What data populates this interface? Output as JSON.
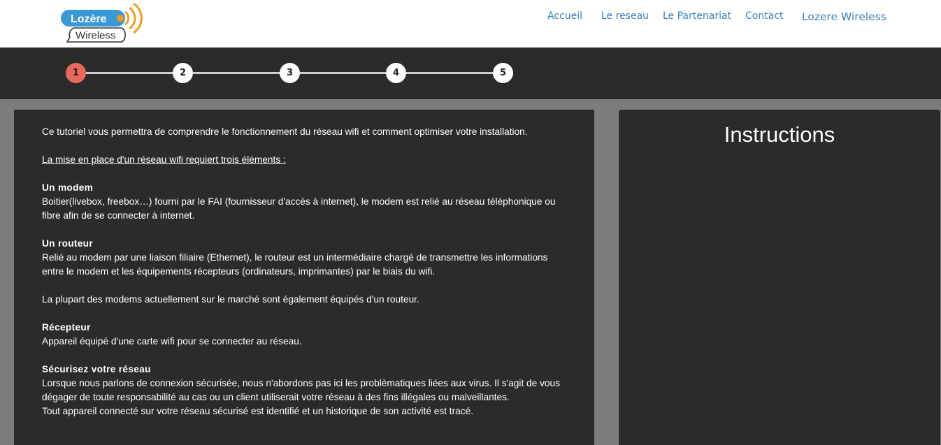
{
  "logo": {
    "line1": "Lozère",
    "line2": "Wireless",
    "colors": {
      "blue": "#3b98d6",
      "orange": "#f39a1f",
      "dark": "#333333"
    }
  },
  "nav": {
    "items": [
      "Accueil",
      "Le reseau",
      "Le Partenariat",
      "Contact"
    ],
    "brand": "Lozere Wireless"
  },
  "steps": {
    "items": [
      "1",
      "2",
      "3",
      "4",
      "5"
    ],
    "active_index": 0,
    "active_color": "#e8685a"
  },
  "content": {
    "intro": "Ce tutoriel vous permettra de comprendre le fonctionnement du réseau wifi et comment optimiser votre installation.",
    "subtitle": "La mise en place d'un réseau wifi requiert trois éléments :",
    "modem_title": "Un modem",
    "modem_text": "Boitier(livebox, freebox…) fourni par le FAI (fournisseur d'accès à internet), le modem est relié au réseau téléphonique ou fibre afin de se connecter à internet.",
    "router_title": "Un routeur",
    "router_text": "Relié au modem par une liaison filiaire (Ethernet), le routeur est un intermédiaire chargé de transmettre les informations entre le modem et les équipements récepteurs (ordinateurs, imprimantes) par le biais du wifi.",
    "router_note": "La plupart des modems actuellement sur le marché sont également équipés d'un routeur.",
    "receiver_title": "Récepteur",
    "receiver_text": "Appareil équipé d'une carte wifi pour se connecter au réseau.",
    "security_title": "Sécurisez votre réseau",
    "security_text1": "Lorsque nous parlons de connexion sécurisée, nous n'abordons pas ici les problèmatiques liées aux virus. Il s'agit de vous dégager de toute responsabilité au cas ou un client utiliserait votre réseau à des fins illégales ou malveillantes.",
    "security_text2": "Tout appareil connecté sur votre réseau sécurisé est identifié et un historique de son activité est tracé."
  },
  "instructions": {
    "title": "Instructions"
  }
}
